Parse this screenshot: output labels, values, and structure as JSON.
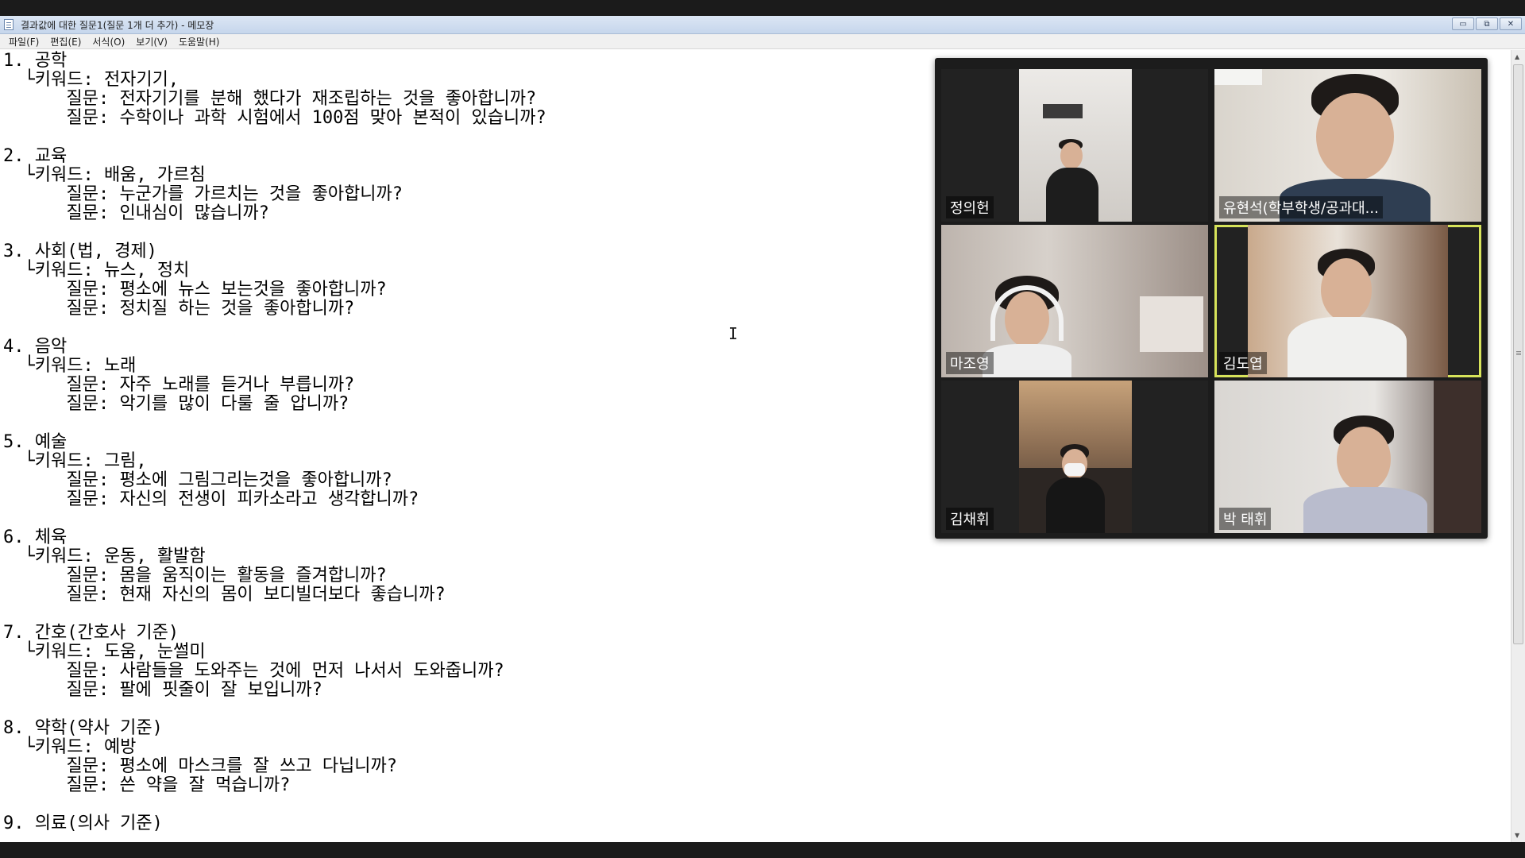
{
  "window": {
    "title": "결과값에 대한 질문1(질문 1개 더 추가) - 메모장",
    "controls": [
      "▭",
      "⧉",
      "✕"
    ]
  },
  "menu": [
    "파일(F)",
    "편집(E)",
    "서식(O)",
    "보기(V)",
    "도움말(H)"
  ],
  "document": {
    "lines": [
      "1. 공학",
      "  └키워드: 전자기기,",
      "      질문: 전자기기를 분해 했다가 재조립하는 것을 좋아합니까?",
      "      질문: 수학이나 과학 시험에서 100점 맞아 본적이 있습니까?",
      "",
      "2. 교육",
      "  └키워드: 배움, 가르침",
      "      질문: 누군가를 가르치는 것을 좋아합니까?",
      "      질문: 인내심이 많습니까?",
      "",
      "3. 사회(법, 경제)",
      "  └키워드: 뉴스, 정치",
      "      질문: 평소에 뉴스 보는것을 좋아합니까?",
      "      질문: 정치질 하는 것을 좋아합니까?",
      "",
      "4. 음악",
      "  └키워드: 노래",
      "      질문: 자주 노래를 듣거나 부릅니까?",
      "      질문: 악기를 많이 다룰 줄 압니까?",
      "",
      "5. 예술",
      "  └키워드: 그림,",
      "      질문: 평소에 그림그리는것을 좋아합니까?",
      "      질문: 자신의 전생이 피카소라고 생각합니까?",
      "",
      "6. 체육",
      "  └키워드: 운동, 활발함",
      "      질문: 몸을 움직이는 활동을 즐겨합니까?",
      "      질문: 현재 자신의 몸이 보디빌더보다 좋습니까?",
      "",
      "7. 간호(간호사 기준)",
      "  └키워드: 도움, 눈썰미",
      "      질문: 사람들을 도와주는 것에 먼저 나서서 도와줍니까?",
      "      질문: 팔에 핏줄이 잘 보입니까?",
      "",
      "8. 약학(약사 기준)",
      "  └키워드: 예방",
      "      질문: 평소에 마스크를 잘 쓰고 다닙니까?",
      "      질문: 쓴 약을 잘 먹습니까?",
      "",
      "9. 의료(의사 기준)"
    ]
  },
  "video_call": {
    "participants": [
      {
        "name": "정의헌",
        "active": false
      },
      {
        "name": "유현석(학부학생/공과대...",
        "active": false
      },
      {
        "name": "마조영",
        "active": false
      },
      {
        "name": "김도엽",
        "active": true
      },
      {
        "name": "김채휘",
        "active": false
      },
      {
        "name": "박 태휘",
        "active": false
      }
    ]
  },
  "colors": {
    "active_speaker_border": "#d7e35a",
    "titlebar": "#c6d6ec",
    "panel_bg": "#1c1c1c"
  }
}
